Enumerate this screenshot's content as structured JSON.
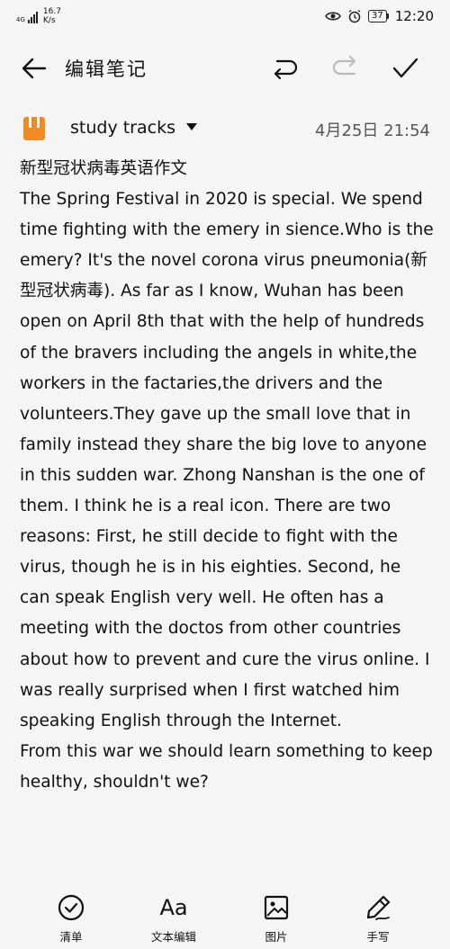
{
  "status_bar": {
    "network": "4G",
    "speed_value": "16.7",
    "speed_unit": "K/s",
    "battery": "37",
    "time": "12:20"
  },
  "toolbar": {
    "title": "编辑笔记",
    "back_icon": "arrow-left-icon",
    "undo_icon": "undo-icon",
    "redo_icon": "redo-icon",
    "save_icon": "check-icon"
  },
  "note_meta": {
    "folder": "study tracks",
    "date": "4月25日 21:54",
    "folder_color": "#f08a24"
  },
  "note": {
    "paragraphs": [
      "新型冠状病毒英语作文",
      "The Spring Festival in 2020 is special. We spend time fighting with the emery in sience.Who is the emery? It's the novel corona virus pneumonia(新型冠状病毒). As far as I know, Wuhan has been open on April 8th that with the help of hundreds of the bravers including the angels in white,the workers in the factaries,the drivers and the volunteers.They gave up the small love that in family instead they share the big love to anyone in this sudden war. Zhong Nanshan is the one of them. I think he is a real icon. There are two reasons:  First, he still decide to fight with the virus, though he is in his eighties. Second, he can speak English  very well. He often has a meeting with the doctos from other countries about how to prevent and cure the virus online. I was really surprised when I first watched him speaking English through the Internet.",
      "From this war we should learn something to keep healthy, shouldn't we?"
    ]
  },
  "bottom_bar": {
    "items": [
      {
        "label": "清单",
        "icon": "checklist-icon"
      },
      {
        "label": "Aa",
        "icon": "text-format-icon"
      },
      {
        "label": "文本编辑"
      },
      {
        "label": "图片",
        "icon": "image-icon"
      },
      {
        "label": "手写",
        "icon": "handwriting-icon"
      }
    ]
  }
}
